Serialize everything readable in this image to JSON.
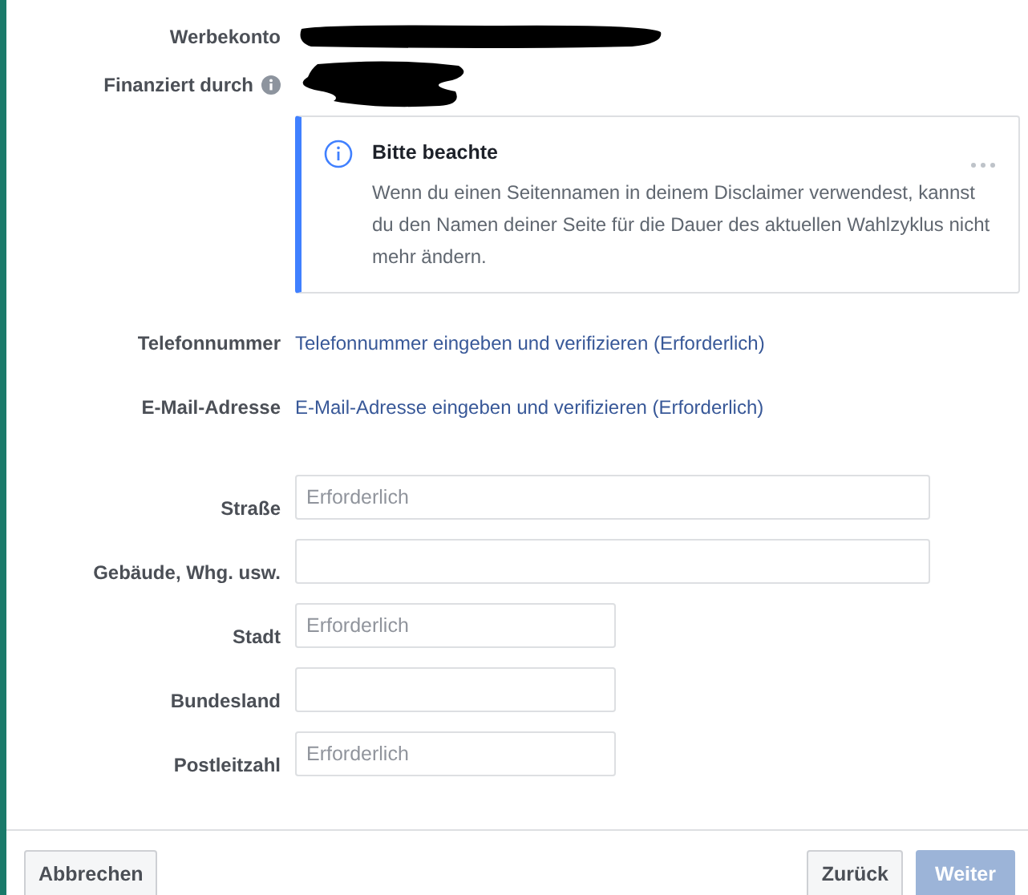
{
  "account_rows": [
    {
      "label": "Werbekonto",
      "info": false
    },
    {
      "label": "Finanziert durch",
      "info": true
    }
  ],
  "notice": {
    "title": "Bitte beachte",
    "text": "Wenn du einen Seitennamen in deinem Disclaimer verwendest, kannst du den Namen deiner Seite für die Dauer des aktuellen Wahlzyklus nicht mehr ändern."
  },
  "contact_rows": [
    {
      "label": "Telefonnummer",
      "link": "Telefonnummer eingeben und verifizieren (Erforderlich)"
    },
    {
      "label": "E-Mail-Adresse",
      "link": "E-Mail-Adresse eingeben und verifizieren (Erforderlich)"
    }
  ],
  "address_fields": [
    {
      "label": "Straße",
      "placeholder": "Erforderlich",
      "kind": "wide"
    },
    {
      "label": "Gebäude, Whg. usw.",
      "kind": "wide"
    },
    {
      "label": "Stadt",
      "placeholder": "Erforderlich",
      "kind": "short"
    },
    {
      "label": "Bundesland",
      "kind": "short"
    },
    {
      "label": "Postleitzahl",
      "placeholder": "Erforderlich",
      "kind": "short"
    }
  ],
  "footer": {
    "left_buttons": [
      {
        "label": "Abbrechen",
        "disabled": false
      }
    ],
    "right_buttons": [
      {
        "label": "Zurück",
        "disabled": false
      },
      {
        "label": "Weiter",
        "disabled": true
      }
    ]
  }
}
